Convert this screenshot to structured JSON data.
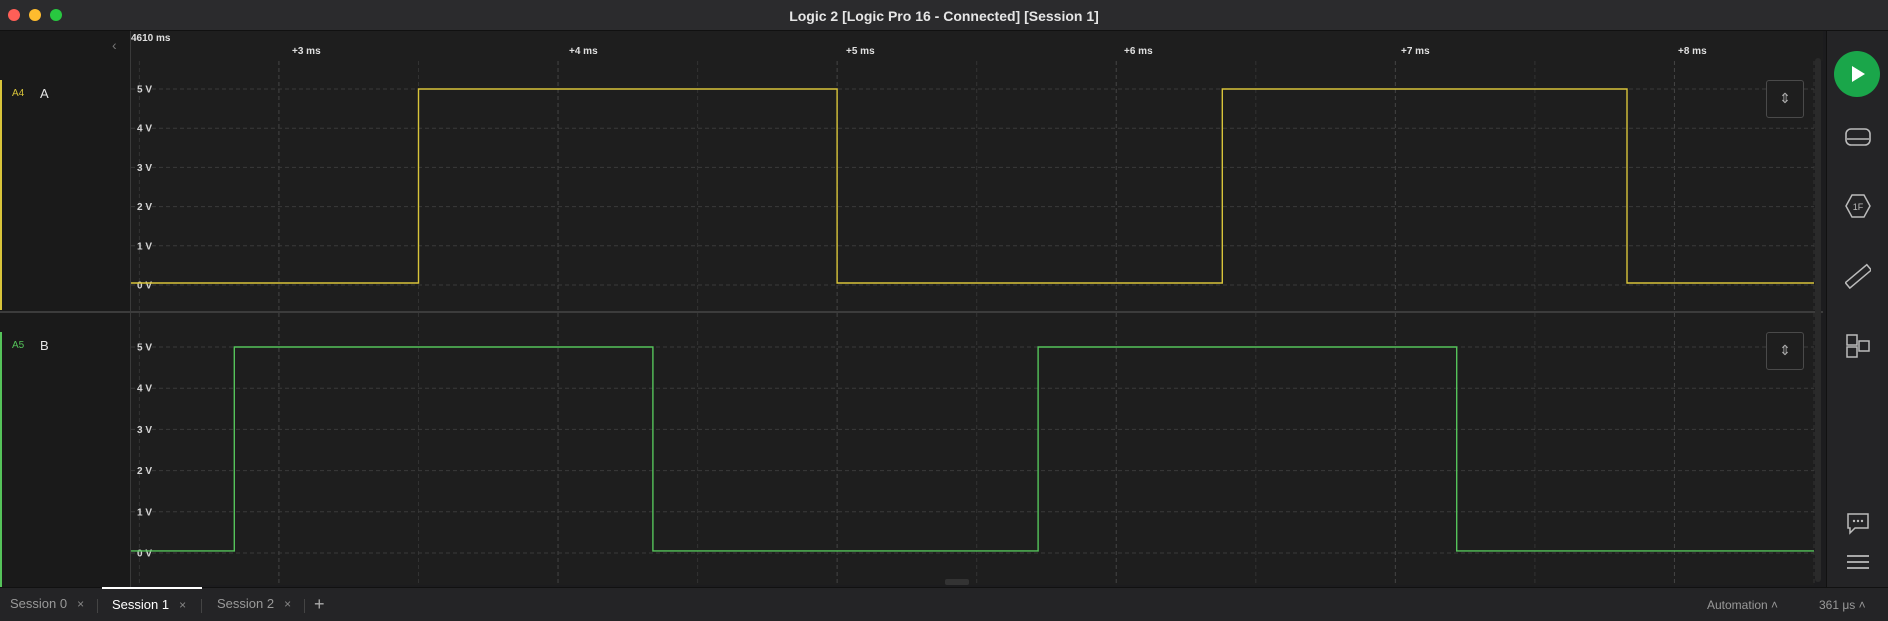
{
  "window": {
    "title": "Logic 2 [Logic Pro 16 - Connected] [Session 1]"
  },
  "timeline": {
    "start_label": "4610 ms",
    "ticks": [
      "+3 ms",
      "+4 ms",
      "+5 ms",
      "+6 ms",
      "+7 ms",
      "+8 ms"
    ]
  },
  "channels": [
    {
      "id": "A4",
      "name": "A",
      "color": "#d8c43a",
      "y_labels": [
        "5 V",
        "4 V",
        "3 V",
        "2 V",
        "1 V",
        "0 V"
      ]
    },
    {
      "id": "A5",
      "name": "B",
      "color": "#55c35a",
      "y_labels": [
        "5 V",
        "4 V",
        "3 V",
        "2 V",
        "1 V",
        "0 V"
      ]
    }
  ],
  "chart_data": {
    "type": "line",
    "x_unit": "ms (relative)",
    "xlim": [
      2.47,
      8.5
    ],
    "ylim": [
      0,
      5
    ],
    "series": [
      {
        "name": "A",
        "points": [
          [
            2.47,
            0.05
          ],
          [
            3.5,
            0.05
          ],
          [
            3.5,
            5.0
          ],
          [
            5.0,
            5.0
          ],
          [
            5.0,
            0.05
          ],
          [
            6.38,
            0.05
          ],
          [
            6.38,
            5.0
          ],
          [
            7.83,
            5.0
          ],
          [
            7.83,
            0.05
          ],
          [
            8.5,
            0.05
          ]
        ]
      },
      {
        "name": "B",
        "points": [
          [
            2.47,
            0.05
          ],
          [
            2.84,
            0.05
          ],
          [
            2.84,
            5.0
          ],
          [
            4.34,
            5.0
          ],
          [
            4.34,
            0.05
          ],
          [
            5.72,
            0.05
          ],
          [
            5.72,
            5.0
          ],
          [
            7.22,
            5.0
          ],
          [
            7.22,
            0.05
          ],
          [
            8.5,
            0.05
          ]
        ]
      }
    ]
  },
  "tabs": [
    {
      "label": "Session 0",
      "active": false
    },
    {
      "label": "Session 1",
      "active": true
    },
    {
      "label": "Session 2",
      "active": false
    }
  ],
  "status": {
    "automation": "Automation ˄",
    "duration": "361 μs ˄"
  },
  "right_tools": [
    "play-icon",
    "device-icon",
    "analyzer-icon",
    "measure-icon",
    "extensions-icon",
    "comment-icon",
    "menu-icon"
  ]
}
